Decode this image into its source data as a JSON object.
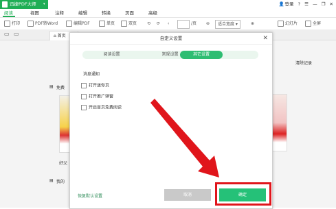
{
  "app": {
    "name": "迅捷PDF大师"
  },
  "titlebar": {
    "login": "登录",
    "controls": [
      "?",
      "☰",
      "—",
      "❐",
      "✕"
    ]
  },
  "menu": {
    "items": [
      "阅读",
      "视图",
      "注释",
      "编辑",
      "转换",
      "页面",
      "高级"
    ],
    "active": "阅读"
  },
  "toolbar": {
    "print": "打印",
    "pdf2word": "PDF转Word",
    "editpdf": "编辑PDF",
    "single": "单页",
    "double": "双页",
    "page_value": "",
    "page_suffix": "/页",
    "fit_width": "适合宽度",
    "slideshow": "幻灯片",
    "fullscreen": "全屏"
  },
  "doctab": {
    "home": "首页"
  },
  "background": {
    "recent_label": "免费",
    "clear": "清除记录",
    "book_caption": "好父",
    "my_label": "我的"
  },
  "dialog": {
    "title": "自定义设置",
    "tabs": [
      "阅读设置",
      "常规设置",
      "其它设置"
    ],
    "active_tab": "其它设置",
    "section": "消息通知",
    "options": [
      {
        "label": "打开迷你页",
        "checked": false
      },
      {
        "label": "打开推广弹窗",
        "checked": false
      },
      {
        "label": "开启首页免费阅读",
        "checked": false
      }
    ],
    "restore": "恢复默认设置",
    "cancel": "取消",
    "ok": "确定"
  },
  "colors": {
    "accent": "#1fae55",
    "ok_button": "#25c178",
    "annotation": "#e0151b"
  }
}
